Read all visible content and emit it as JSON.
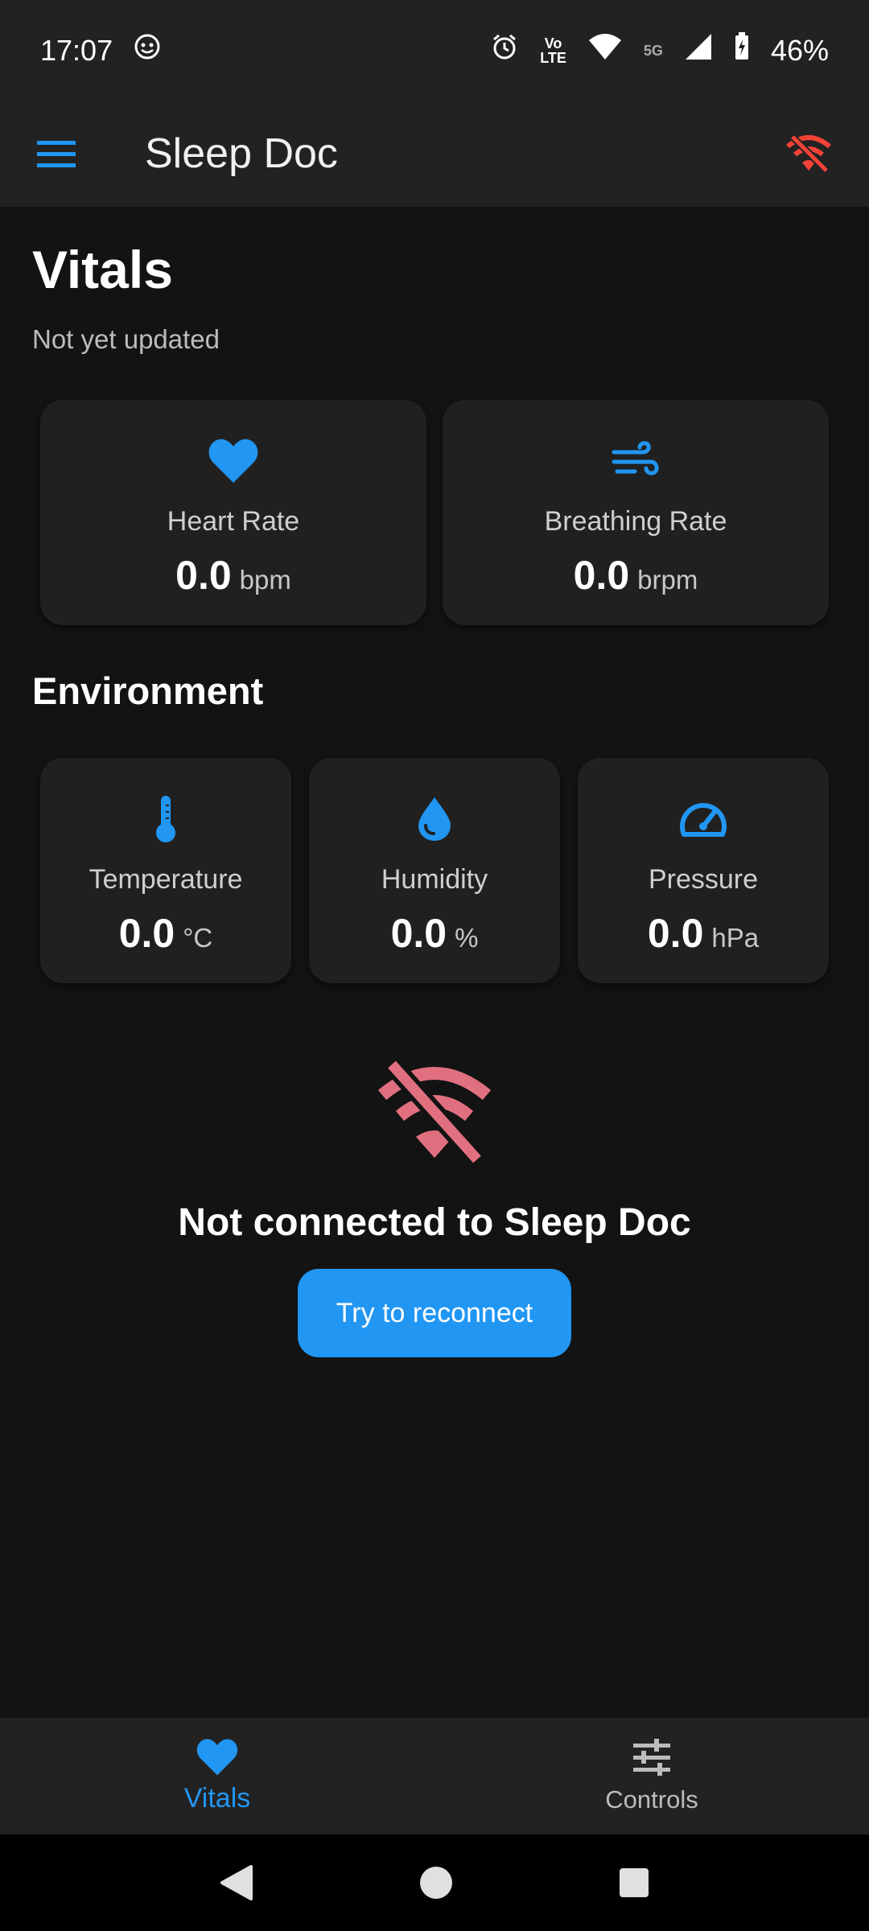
{
  "status_bar": {
    "time": "17:07",
    "volte_top": "Vo",
    "volte_bottom": "LTE",
    "network": "5G",
    "battery": "46%"
  },
  "app_bar": {
    "title": "Sleep Doc",
    "menu_icon": "menu-icon",
    "status_icon": "wifi-off-icon"
  },
  "vitals": {
    "title": "Vitals",
    "subtitle": "Not yet updated",
    "cards": [
      {
        "label": "Heart Rate",
        "value": "0.0",
        "unit": "bpm",
        "icon": "heart-icon"
      },
      {
        "label": "Breathing Rate",
        "value": "0.0",
        "unit": "brpm",
        "icon": "wind-icon"
      }
    ]
  },
  "environment": {
    "title": "Environment",
    "cards": [
      {
        "label": "Temperature",
        "value": "0.0",
        "unit": "°C",
        "icon": "thermometer-icon"
      },
      {
        "label": "Humidity",
        "value": "0.0",
        "unit": "%",
        "icon": "water-drop-icon"
      },
      {
        "label": "Pressure",
        "value": "0.0",
        "unit": "hPa",
        "icon": "speedometer-icon"
      }
    ]
  },
  "connection": {
    "message": "Not connected to Sleep Doc",
    "button_label": "Try to reconnect"
  },
  "bottom_nav": {
    "items": [
      {
        "label": "Vitals",
        "icon": "heart-icon",
        "active": true
      },
      {
        "label": "Controls",
        "icon": "tune-icon",
        "active": false
      }
    ]
  },
  "colors": {
    "accent": "#2196f3",
    "error": "#f44336",
    "error_muted": "#e07080",
    "background": "#131313",
    "surface": "#202020"
  }
}
